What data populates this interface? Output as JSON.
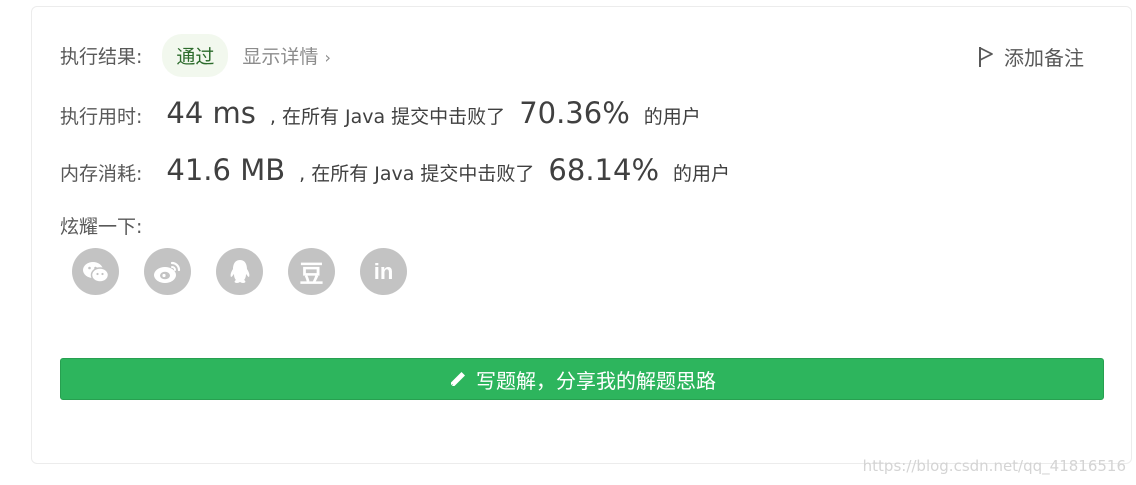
{
  "result": {
    "label": "执行结果:",
    "status": "通过",
    "details": "显示详情",
    "details_chevron": "›",
    "note_label": "添加备注"
  },
  "runtime": {
    "label": "执行用时:",
    "value": "44 ms",
    "text_before": ", 在所有 Java 提交中击败了",
    "percent": "70.36%",
    "text_after": "的用户"
  },
  "memory": {
    "label": "内存消耗:",
    "value": "41.6 MB",
    "text_before": ", 在所有 Java 提交中击败了",
    "percent": "68.14%",
    "text_after": "的用户"
  },
  "share": {
    "label": "炫耀一下:",
    "icons": [
      "wechat-icon",
      "weibo-icon",
      "qq-icon",
      "douban-icon",
      "linkedin-icon"
    ],
    "douban_glyph": "豆",
    "linkedin_glyph": "in"
  },
  "cta": {
    "label": "写题解，分享我的解题思路"
  },
  "watermark": "https://blog.csdn.net/qq_41816516",
  "colors": {
    "accent_green": "#2db55d",
    "badge_bg": "#f2f8ee",
    "icon_gray": "#c3c3c3"
  }
}
